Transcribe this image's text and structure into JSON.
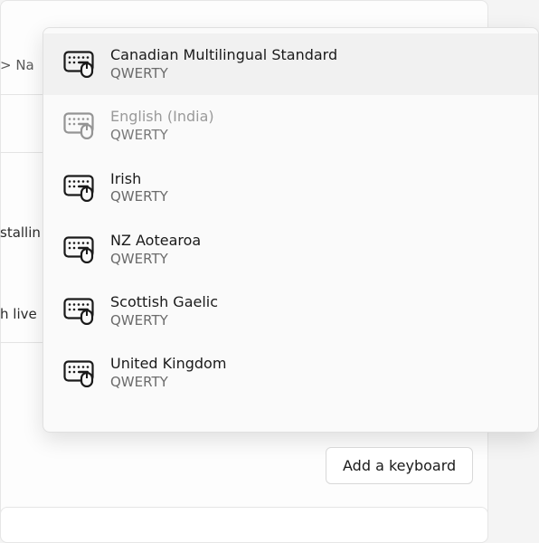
{
  "breadcrumb": {
    "fragment": " > Na"
  },
  "background_text": {
    "line1": "stallin",
    "line2": "h live"
  },
  "keyboards": [
    {
      "title": "Canadian Multilingual Standard",
      "layout": "QWERTY",
      "state": "selected"
    },
    {
      "title": "English (India)",
      "layout": "QWERTY",
      "state": "disabled"
    },
    {
      "title": "Irish",
      "layout": "QWERTY",
      "state": "normal"
    },
    {
      "title": "NZ Aotearoa",
      "layout": "QWERTY",
      "state": "normal"
    },
    {
      "title": "Scottish Gaelic",
      "layout": "QWERTY",
      "state": "normal"
    },
    {
      "title": "United Kingdom",
      "layout": "QWERTY",
      "state": "normal"
    }
  ],
  "add_button": {
    "label": "Add a keyboard"
  }
}
